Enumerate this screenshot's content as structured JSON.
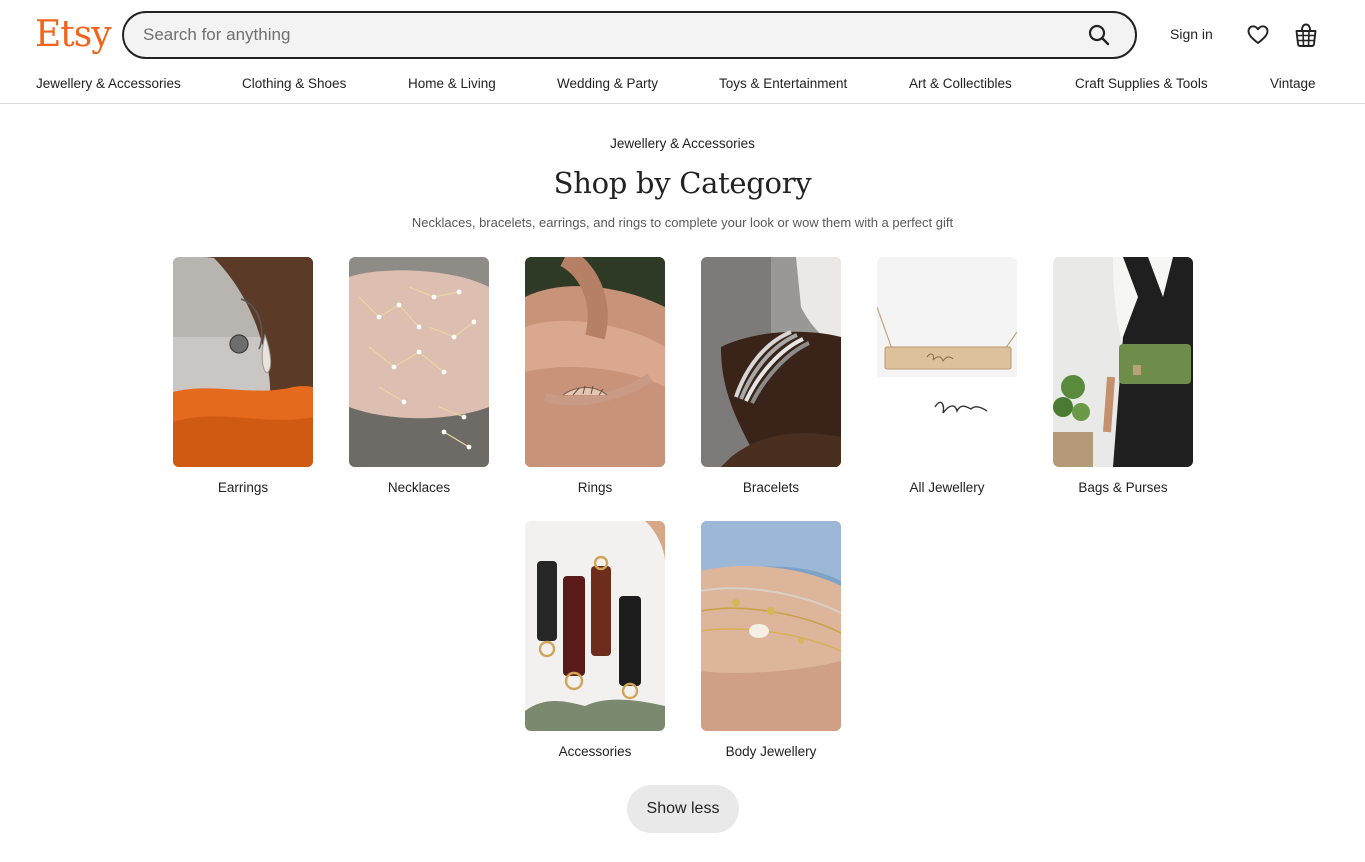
{
  "header": {
    "logo": "Etsy",
    "search_placeholder": "Search for anything",
    "sign_in": "Sign in"
  },
  "nav": [
    "Jewellery & Accessories",
    "Clothing & Shoes",
    "Home & Living",
    "Wedding & Party",
    "Toys & Entertainment",
    "Art & Collectibles",
    "Craft Supplies & Tools",
    "Vintage"
  ],
  "main": {
    "breadcrumb": "Jewellery & Accessories",
    "title": "Shop by Category",
    "subtitle": "Necklaces, bracelets, earrings, and rings to complete your look or wow them with a perfect gift",
    "categories": [
      "Earrings",
      "Necklaces",
      "Rings",
      "Bracelets",
      "All Jewellery",
      "Bags & Purses",
      "Accessories",
      "Body Jewellery"
    ],
    "show_less": "Show less"
  },
  "colors": {
    "brand": "#f1641e",
    "text": "#222222",
    "search_bg": "#f3f3f3",
    "button_bg": "#e9e9e9"
  }
}
